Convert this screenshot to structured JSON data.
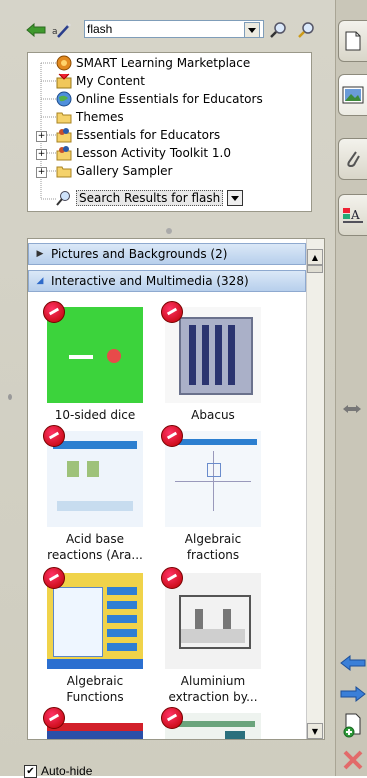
{
  "toolbar": {
    "search_value": "flash",
    "back_icon": "back-arrow-icon",
    "properties_icon": "magic-pen-icon",
    "search_icon": "magnifier-icon",
    "advanced_search_icon": "magnifier-pen-icon"
  },
  "tree": {
    "items": [
      {
        "label": "SMART Learning Marketplace",
        "icon": "marketplace-icon"
      },
      {
        "label": "My Content",
        "icon": "my-content-icon"
      },
      {
        "label": "Online Essentials for Educators",
        "icon": "globe-icon"
      },
      {
        "label": "Themes",
        "icon": "folder-icon"
      },
      {
        "label": "Essentials for Educators",
        "icon": "people-folder-icon"
      },
      {
        "label": "Lesson Activity Toolkit 1.0",
        "icon": "people-folder-icon"
      },
      {
        "label": "Gallery Sampler",
        "icon": "folder-icon"
      },
      {
        "label": "Search Results for flash",
        "icon": "search-icon"
      }
    ]
  },
  "categories": [
    {
      "label": "Pictures and Backgrounds (2)",
      "expanded": false
    },
    {
      "label": "Interactive and Multimedia (328)",
      "expanded": true
    }
  ],
  "gallery": {
    "items": [
      {
        "line1": "10-sided dice",
        "line2": ""
      },
      {
        "line1": "Abacus",
        "line2": ""
      },
      {
        "line1": "Acid base",
        "line2": "reactions (Ara..."
      },
      {
        "line1": "Algebraic",
        "line2": "fractions"
      },
      {
        "line1": "Algebraic",
        "line2": "Functions"
      },
      {
        "line1": "Aluminium",
        "line2": "extraction by..."
      },
      {
        "line1": "",
        "line2": ""
      },
      {
        "line1": "",
        "line2": ""
      }
    ]
  },
  "sidebar": {
    "tabs": [
      "page-sorter-icon",
      "gallery-icon",
      "attachments-icon",
      "properties-icon"
    ],
    "resize_icon": "resize-arrows-icon",
    "bottom_buttons": [
      "move-left-icon",
      "move-right-icon",
      "add-page-icon",
      "delete-icon"
    ]
  },
  "footer": {
    "autohide_label": "Auto-hide",
    "autohide_checked": true
  },
  "colors": {
    "panel": "#d6d4c9",
    "category_bar": "#b7cfec",
    "accent_blue": "#2e6ac9",
    "badge_red": "#cc0022"
  }
}
